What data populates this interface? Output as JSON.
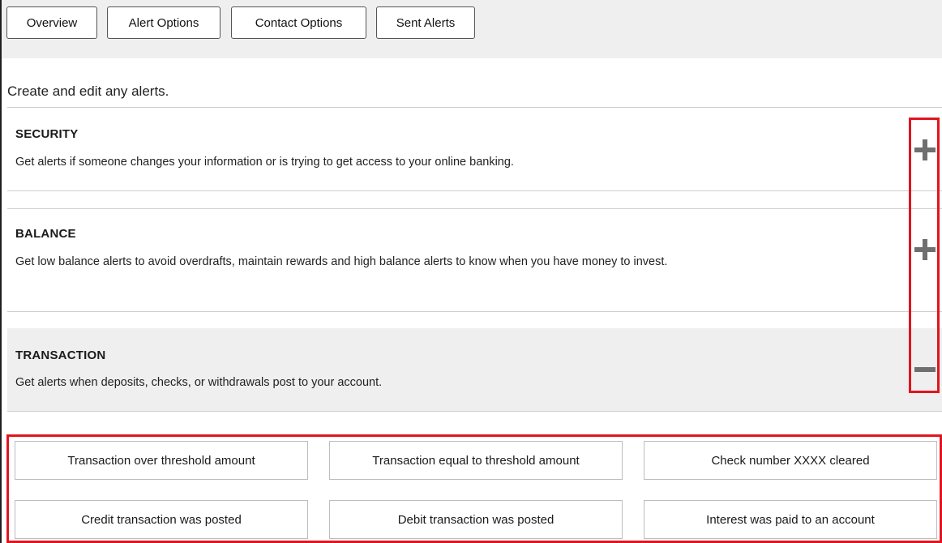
{
  "tabs": [
    {
      "label": "Overview"
    },
    {
      "label": "Alert Options"
    },
    {
      "label": "Contact Options"
    },
    {
      "label": "Sent Alerts"
    }
  ],
  "intro": "Create and edit any alerts.",
  "sections": [
    {
      "title": "SECURITY",
      "description": "Get alerts if someone changes your information or is trying to get access to your online banking.",
      "toggle_icon": "plus-icon",
      "expanded": false
    },
    {
      "title": "BALANCE",
      "description": "Get low balance alerts to avoid overdrafts, maintain rewards and high balance alerts to know when you have money to invest.",
      "toggle_icon": "plus-icon",
      "expanded": false
    },
    {
      "title": "TRANSACTION",
      "description": "Get alerts when deposits, checks, or withdrawals post to your account.",
      "toggle_icon": "minus-icon",
      "expanded": true
    }
  ],
  "transaction_options": [
    {
      "label": "Transaction over threshold amount"
    },
    {
      "label": "Transaction equal to threshold amount"
    },
    {
      "label": "Check number XXXX cleared"
    },
    {
      "label": "Credit transaction was posted"
    },
    {
      "label": "Debit transaction was posted"
    },
    {
      "label": "Interest was paid to an account"
    }
  ],
  "colors": {
    "highlight": "#e0151f",
    "toggle_icon": "#6f6f6f",
    "expanded_background": "#efefef"
  }
}
